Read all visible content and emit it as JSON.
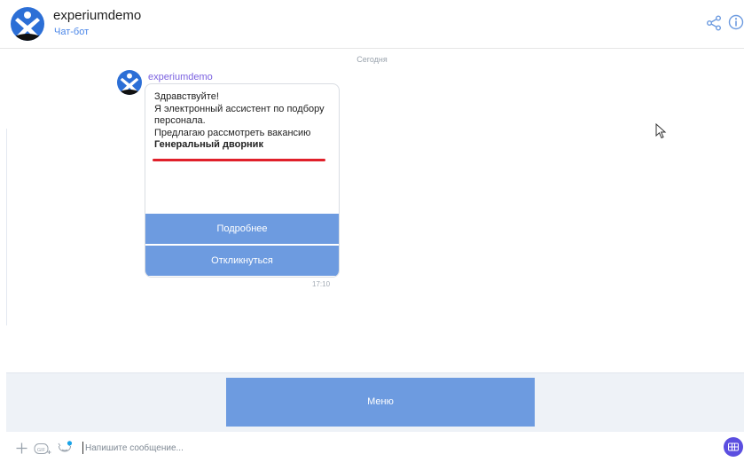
{
  "header": {
    "title": "experiumdemo",
    "subtitle": "Чат-бот",
    "icons": [
      "bot-logo",
      "share-icon",
      "info-icon"
    ]
  },
  "chat": {
    "date_separator": "Сегодня",
    "message": {
      "author": "experiumdemo",
      "lines": [
        "Здравствуйте!",
        "Я электронный ассистент по подбору",
        "персонала.",
        "Предлагаю рассмотреть вакансию"
      ],
      "vacancy": "Генеральный дворник",
      "buttons": [
        "Подробнее",
        "Откликнуться"
      ],
      "time": "17:10"
    }
  },
  "menu": {
    "button_label": "Меню"
  },
  "composer": {
    "placeholder": "Напишите сообщение...",
    "icons": [
      "plus-icon",
      "gif-icon",
      "sticker-icon",
      "keyboard-icon"
    ]
  },
  "colors": {
    "accent_blue": "#6d9be0",
    "author_purple": "#7b61e0",
    "subtitle_blue": "#4a86e8",
    "highlight_red": "#e0202a",
    "keyboard_button": "#5b4ee0"
  }
}
